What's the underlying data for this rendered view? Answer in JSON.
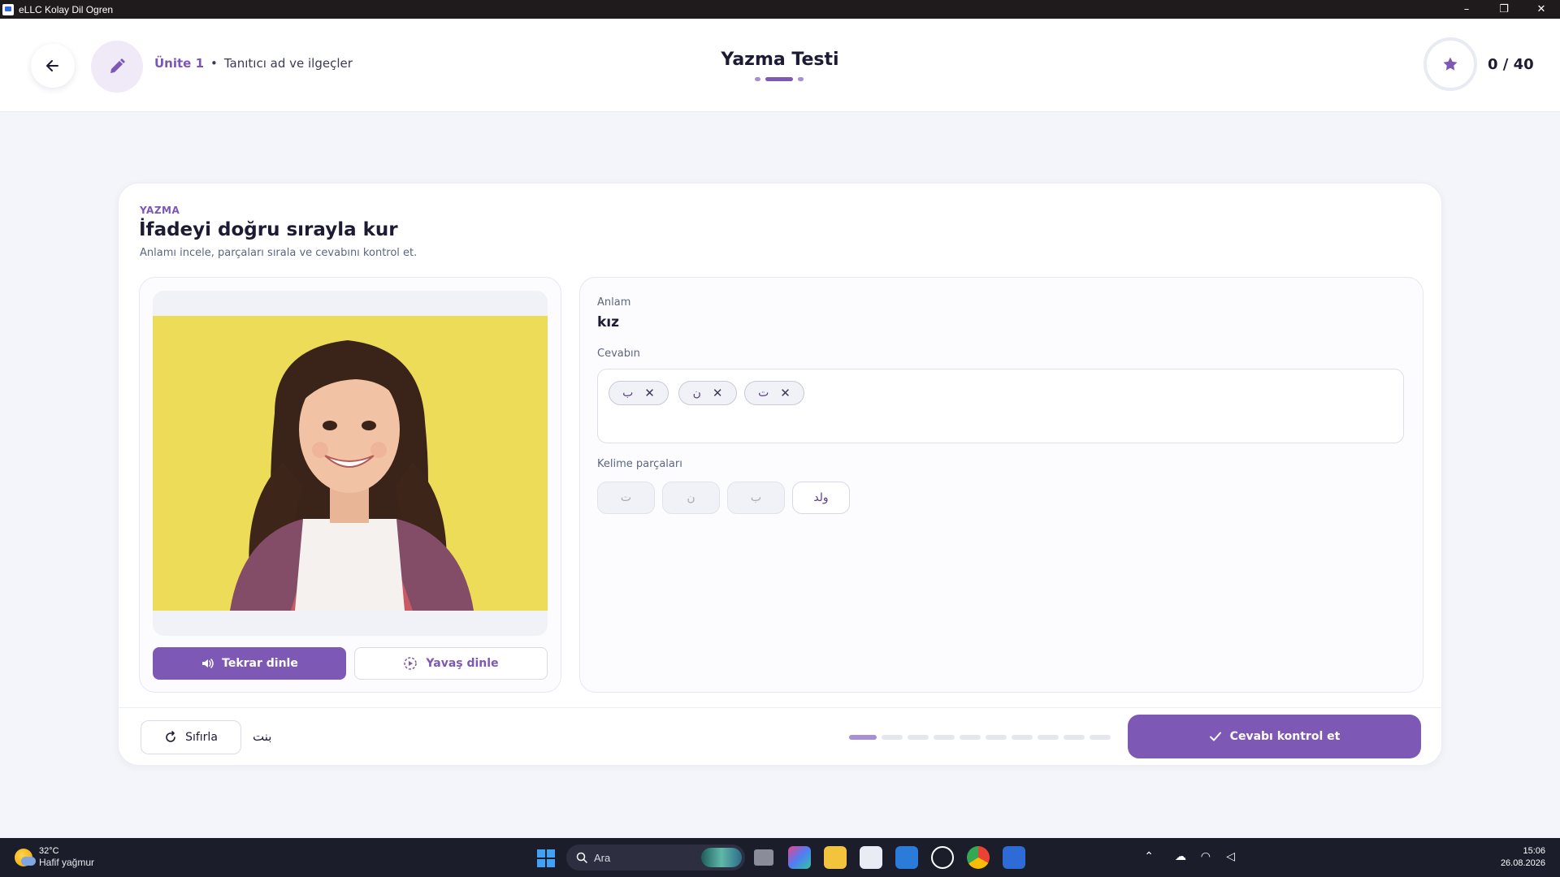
{
  "window": {
    "title": "eLLC Kolay Dil Ogren",
    "controls": [
      "–",
      "❐",
      "✕"
    ]
  },
  "header": {
    "unit_label": "Ünite 1",
    "unit_separator": "•",
    "unit_topic": "Tanıtıcı ad ve ilgeçler",
    "page_title": "Yazma Testi",
    "score": "0 / 40"
  },
  "exercise": {
    "section": "YAZMA",
    "title": "İfadeyi doğru sırayla kur",
    "subtitle": "Anlamı incele, parçaları sırala ve cevabını kontrol et.",
    "replay_label": "Tekrar dinle",
    "slow_label": "Yavaş dinle",
    "meaning_label": "Anlam",
    "meaning_value": "kız",
    "answer_label": "Cevabın",
    "answer_chips": [
      "ب",
      "ن",
      "ت"
    ],
    "chip_remove": "✕",
    "pieces_label": "Kelime parçaları",
    "pieces": [
      {
        "text": "ت",
        "used": true
      },
      {
        "text": "ن",
        "used": true
      },
      {
        "text": "ب",
        "used": true
      },
      {
        "text": "ولد",
        "used": false
      }
    ],
    "reset_label": "Sıfırla",
    "answer_preview": "بنت",
    "progress": {
      "current": 1,
      "total": 10
    },
    "check_label": "Cevabı kontrol et"
  },
  "taskbar": {
    "temperature": "32°C",
    "weather": "Hafif yağmur",
    "search_placeholder": "Ara",
    "time": "15:06",
    "date": "26.08.2026"
  },
  "colors": {
    "accent": "#7d58b5",
    "accent_light": "#a98fd6",
    "photo_background": "#f0df5c"
  }
}
